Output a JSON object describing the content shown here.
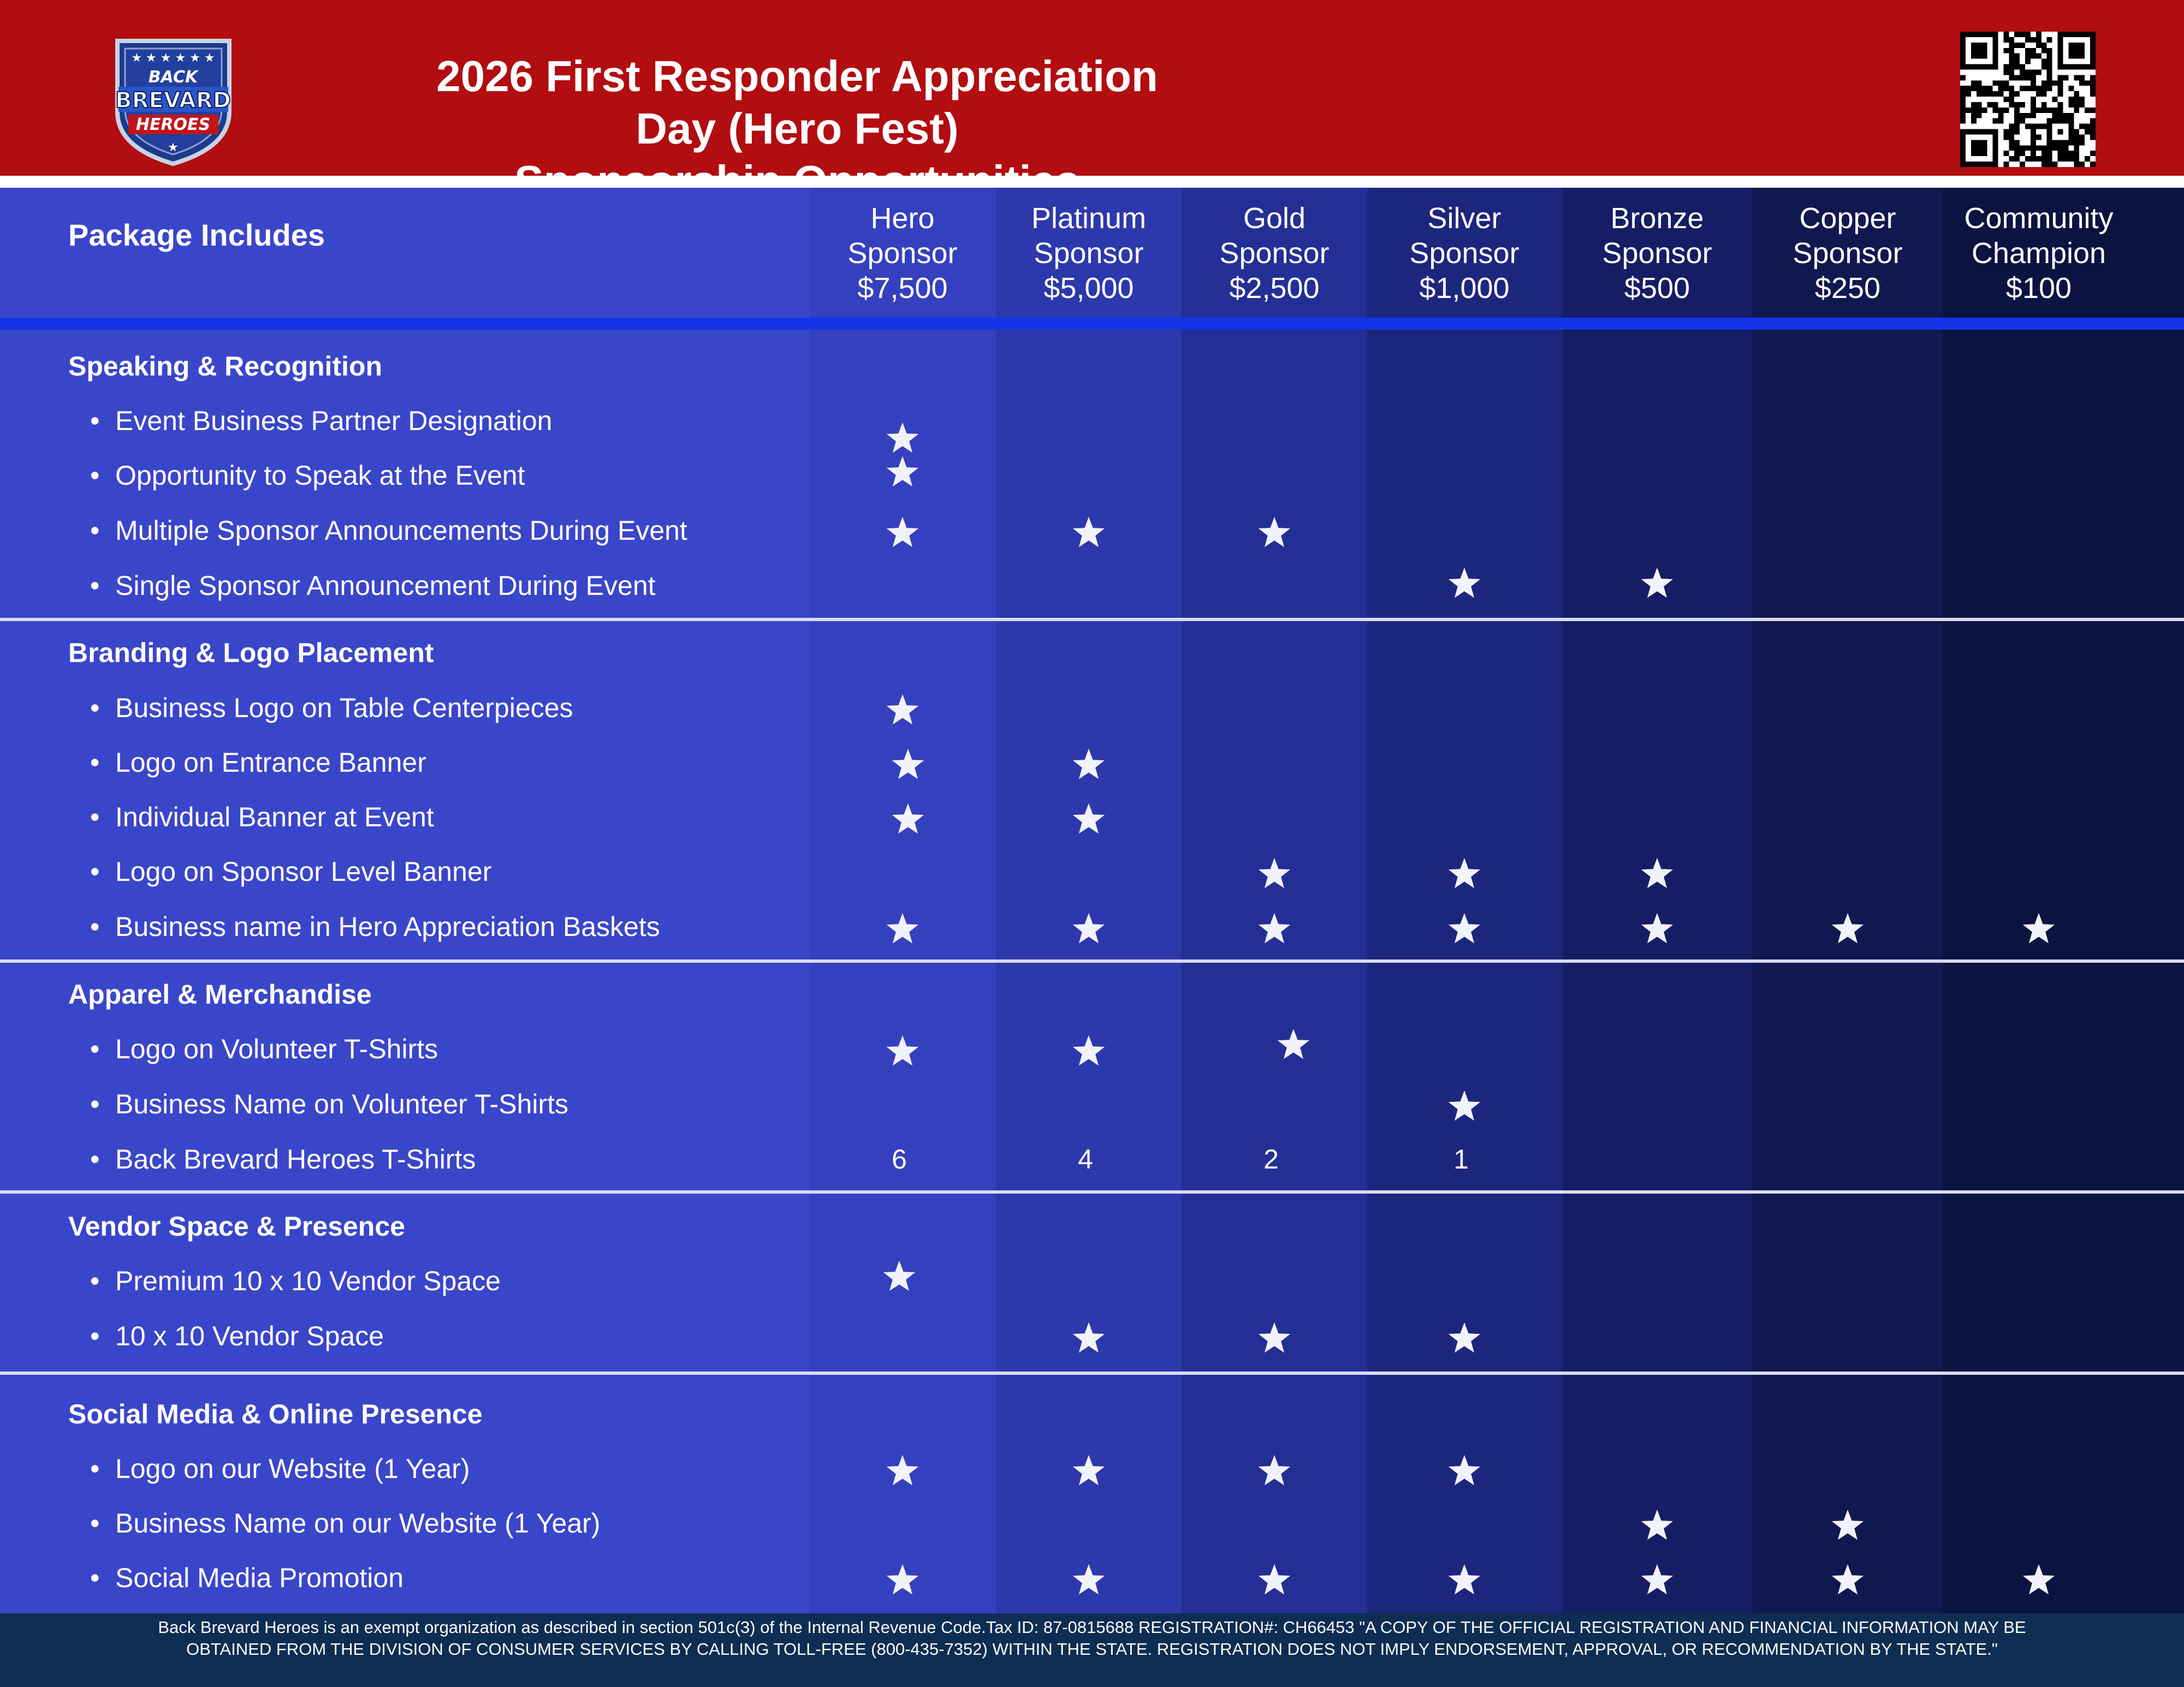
{
  "header": {
    "title_line1": "2026 First Responder Appreciation Day (Hero Fest)",
    "title_line2": "Sponsorship Opportunities",
    "logo_text_top": "BACK",
    "logo_text_mid": "BREVARD",
    "logo_text_bot": "HEROES",
    "qr_icon": "qr-code"
  },
  "colors": {
    "header_red": "#b20d10",
    "accent_blue": "#1235e8",
    "star_white": "#f2f3fa"
  },
  "table": {
    "package_label": "Package Includes",
    "tiers": [
      {
        "line1": "Hero",
        "line2": "Sponsor",
        "price": "$7,500"
      },
      {
        "line1": "Platinum",
        "line2": "Sponsor",
        "price": "$5,000"
      },
      {
        "line1": "Gold",
        "line2": "Sponsor",
        "price": "$2,500"
      },
      {
        "line1": "Silver",
        "line2": "Sponsor",
        "price": "$1,000"
      },
      {
        "line1": "Bronze",
        "line2": "Sponsor",
        "price": "$500"
      },
      {
        "line1": "Copper",
        "line2": "Sponsor",
        "price": "$250"
      },
      {
        "line1": "Community",
        "line2": "Champion",
        "price": "$100"
      }
    ],
    "sections": [
      {
        "title": "Speaking & Recognition",
        "items": [
          {
            "label": "Event Business Partner Designation",
            "marks": [
              "star",
              "",
              "",
              "",
              "",
              "",
              ""
            ]
          },
          {
            "label": "Opportunity to Speak at the Event",
            "marks": [
              "star",
              "",
              "",
              "",
              "",
              "",
              ""
            ]
          },
          {
            "label": "Multiple Sponsor Announcements During Event",
            "marks": [
              "star",
              "star",
              "star",
              "",
              "",
              "",
              ""
            ]
          },
          {
            "label": "Single Sponsor Announcement During Event",
            "marks": [
              "",
              "",
              "",
              "star",
              "star",
              "",
              ""
            ]
          }
        ]
      },
      {
        "title": "Branding & Logo Placement",
        "items": [
          {
            "label": "Business Logo on Table Centerpieces",
            "marks": [
              "star",
              "",
              "",
              "",
              "",
              "",
              ""
            ]
          },
          {
            "label": "Logo on Entrance Banner",
            "marks": [
              "star",
              "star",
              "",
              "",
              "",
              "",
              ""
            ]
          },
          {
            "label": "Individual Banner at Event",
            "marks": [
              "star",
              "star",
              "",
              "",
              "",
              "",
              ""
            ]
          },
          {
            "label": "Logo on Sponsor Level Banner",
            "marks": [
              "",
              "",
              "star",
              "star",
              "star",
              "",
              ""
            ]
          },
          {
            "label": "Business name in Hero Appreciation Baskets",
            "marks": [
              "star",
              "star",
              "star",
              "star",
              "star",
              "star",
              "star"
            ]
          }
        ]
      },
      {
        "title": "Apparel & Merchandise",
        "items": [
          {
            "label": "Logo on Volunteer T-Shirts",
            "marks": [
              "star",
              "star",
              "star",
              "",
              "",
              "",
              ""
            ]
          },
          {
            "label": "Business Name on Volunteer T-Shirts",
            "marks": [
              "",
              "",
              "",
              "star",
              "",
              "",
              ""
            ]
          },
          {
            "label": "Back Brevard Heroes T-Shirts",
            "marks": [
              "6",
              "4",
              "2",
              "1",
              "",
              "",
              ""
            ]
          }
        ]
      },
      {
        "title": "Vendor Space & Presence",
        "items": [
          {
            "label": "Premium 10 x 10 Vendor Space",
            "marks": [
              "star",
              "",
              "",
              "",
              "",
              "",
              ""
            ]
          },
          {
            "label": "10 x 10 Vendor Space",
            "marks": [
              "",
              "star",
              "star",
              "star",
              "",
              "",
              ""
            ]
          }
        ]
      },
      {
        "title": "Social Media & Online Presence",
        "items": [
          {
            "label": "Logo on our Website (1 Year)",
            "marks": [
              "star",
              "star",
              "star",
              "star",
              "",
              "",
              ""
            ]
          },
          {
            "label": "Business Name on our Website (1 Year)",
            "marks": [
              "",
              "",
              "",
              "",
              "star",
              "star",
              ""
            ]
          },
          {
            "label": "Social Media Promotion",
            "marks": [
              "star",
              "star",
              "star",
              "star",
              "star",
              "star",
              "star"
            ]
          }
        ]
      }
    ]
  },
  "footer": {
    "line1": "Back Brevard Heroes is an exempt organization as described in section 501c(3) of the Internal Revenue Code.Tax ID: 87-0815688 REGISTRATION#: CH66453 \"A COPY OF THE OFFICIAL REGISTRATION AND FINANCIAL INFORMATION MAY BE",
    "line2": "OBTAINED FROM THE DIVISION OF CONSUMER SERVICES BY CALLING TOLL-FREE (800-435-7352) WITHIN THE STATE. REGISTRATION DOES NOT IMPLY ENDORSEMENT, APPROVAL, OR RECOMMENDATION BY THE STATE.\""
  }
}
